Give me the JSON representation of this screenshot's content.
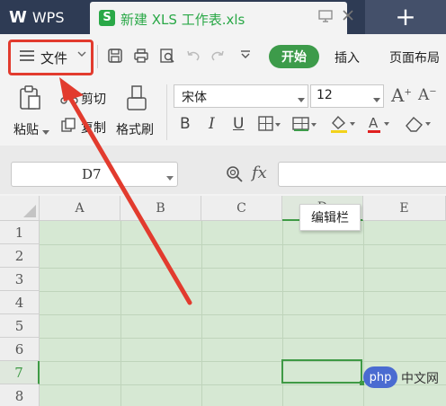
{
  "titlebar": {
    "app_name": "WPS",
    "doc_tab_title": "新建 XLS 工作表.xls",
    "doc_icon_letter": "S",
    "accent": "#2e3b54",
    "doc_icon_color": "#2aa847"
  },
  "menu": {
    "file_label": "文件",
    "tabs": [
      "开始",
      "插入",
      "页面布局"
    ],
    "active_tab_color": "#3d9b4a"
  },
  "ribbon": {
    "paste_label": "粘贴",
    "cut_label": "剪切",
    "copy_label": "复制",
    "format_painter_label": "格式刷",
    "font_name": "宋体",
    "font_size": "12",
    "bold": "B",
    "italic": "I",
    "underline": "U"
  },
  "formula_bar": {
    "name_box": "D7",
    "fx_label": "fx",
    "tooltip": "编辑栏"
  },
  "grid": {
    "columns": [
      "A",
      "B",
      "C",
      "D",
      "E"
    ],
    "rows": [
      "1",
      "2",
      "3",
      "4",
      "5",
      "6",
      "7",
      "8"
    ],
    "selected_cell": "D7",
    "cell_color": "#d6e8d3",
    "selection_color": "#3f9a45"
  },
  "watermark": {
    "logo_text": "php",
    "site_text": "中文网"
  }
}
